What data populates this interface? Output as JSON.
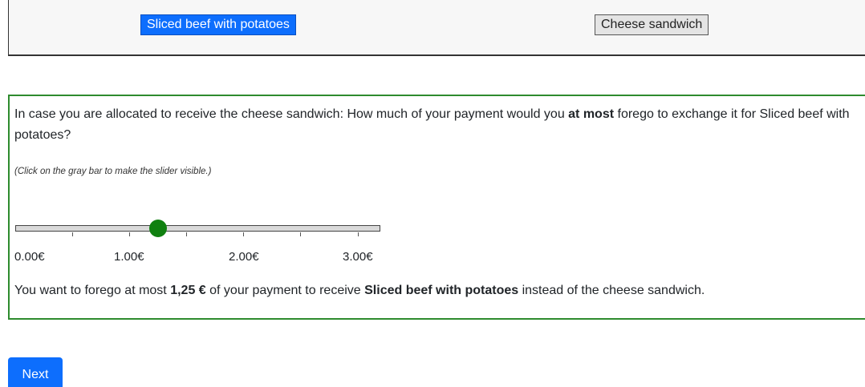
{
  "choices": {
    "selected_label": "Sliced beef with potatoes",
    "unselected_label": "Cheese sandwich"
  },
  "question": {
    "part1": "In case you are allocated to receive the cheese sandwich: How much of your payment would you ",
    "emphasis": "at most",
    "part2": " forego to exchange it for Sliced beef with potatoes?",
    "hint": "(Click on the gray bar to make the slider visible.)"
  },
  "slider": {
    "min": 0,
    "max": 3.2,
    "value": 1.25,
    "tick_labels": [
      "0.00€",
      "1.00€",
      "2.00€",
      "3.00€"
    ],
    "tick_values": [
      0,
      1,
      2,
      3
    ]
  },
  "result": {
    "part1": "You want to forego at most ",
    "amount": "1,25 €",
    "part2": " of your payment to receive ",
    "item": "Sliced beef with potatoes",
    "part3": " instead of the cheese sandwich."
  },
  "navigation": {
    "next_label": "Next"
  },
  "colors": {
    "primary": "#0d6efd",
    "box_border": "#2e8b2e",
    "thumb": "#108010"
  }
}
